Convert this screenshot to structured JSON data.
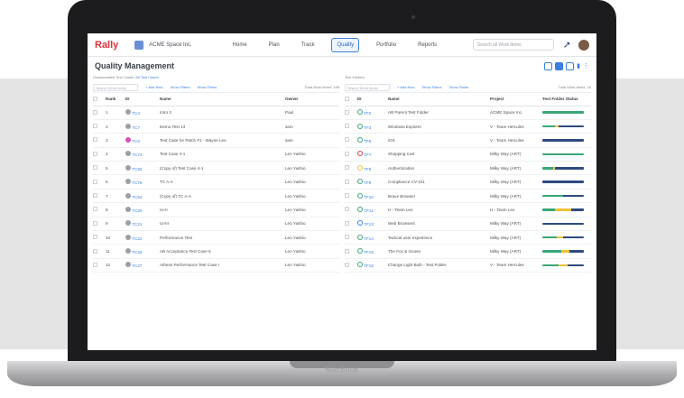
{
  "device": {
    "label": "MacBook"
  },
  "app": {
    "logo": "Rally",
    "workspace": "ACME Space Inc.",
    "nav": [
      "Home",
      "Plan",
      "Track",
      "Quality",
      "Portfolio",
      "Reports"
    ],
    "active_nav": "Quality",
    "search_placeholder": "Search all Work Items",
    "page_title": "Quality Management"
  },
  "test_cases": {
    "label": "Unassociated Test Cases",
    "label_link": "All Test Cases",
    "toolbar": {
      "search": "Search Work Items",
      "add": "+ Add New",
      "filters": "Show Filters",
      "fields": "Show Fields",
      "total": "Total Work Items: 198"
    },
    "columns": [
      "Rank",
      "ID",
      "Name",
      "Owner"
    ],
    "rows": [
      {
        "rank": "1",
        "id": "TC4",
        "name": "Intro 2",
        "owner": "Paul",
        "icon": "grey"
      },
      {
        "rank": "2",
        "id": "TC7",
        "name": "Demo Test 13",
        "owner": "sam",
        "icon": "grey"
      },
      {
        "rank": "3",
        "id": "TC6",
        "name": "Test Case for Patch #1 - Wayne Lee",
        "owner": "sam",
        "icon": "pink"
      },
      {
        "rank": "4",
        "id": "TC74",
        "name": "Test Case 4-1",
        "owner": "Leo Yashio",
        "icon": "grey"
      },
      {
        "rank": "5",
        "id": "TC55",
        "name": "(Copy of) Test Case 4-1",
        "owner": "Leo Yashio",
        "icon": "grey"
      },
      {
        "rank": "6",
        "id": "TC79",
        "name": "TC A-A",
        "owner": "Leo Yashio",
        "icon": "grey"
      },
      {
        "rank": "7",
        "id": "TC54",
        "name": "(Copy of) TC A-A",
        "owner": "Leo Yashio",
        "icon": "grey"
      },
      {
        "rank": "8",
        "id": "TC20",
        "name": "UI-II",
        "owner": "Leo Yashio",
        "icon": "grey"
      },
      {
        "rank": "9",
        "id": "TC21",
        "name": "UI-III",
        "owner": "Leo Yashio",
        "icon": "grey"
      },
      {
        "rank": "10",
        "id": "TC22",
        "name": "Performance Test",
        "owner": "Leo Yashio",
        "icon": "grey"
      },
      {
        "rank": "11",
        "id": "TC25",
        "name": "AB Acceptance Test Case 6",
        "owner": "Leo Yashio",
        "icon": "grey"
      },
      {
        "rank": "12",
        "id": "TC27",
        "name": "Athens Performance Test Case I",
        "owner": "Leo Yashio",
        "icon": "grey"
      }
    ]
  },
  "test_folders": {
    "label": "Test Folders",
    "toolbar": {
      "search": "Search Work Items",
      "add": "+ Add New",
      "filters": "Show Filters",
      "fields": "Show Fields",
      "total": "Total Work Items: 19"
    },
    "columns": [
      "ID",
      "Name",
      "Project",
      "Test Folder Status"
    ],
    "rows": [
      {
        "id": "TF2",
        "name": "AB Parent Test Folder",
        "project": "ACME Space Inc.",
        "icon": "green",
        "status": [
          1.0,
          0,
          0
        ]
      },
      {
        "id": "TF3",
        "name": "Windows Explorer",
        "project": "V - Team Hercules",
        "icon": "green",
        "status": [
          0.3,
          0.1,
          0.6
        ]
      },
      {
        "id": "TF6",
        "name": "iOS",
        "project": "V - Team Hercules",
        "icon": "green",
        "status": [
          0,
          0,
          1.0
        ]
      },
      {
        "id": "TF7",
        "name": "Shopping Cart",
        "project": "Milky Way (ART)",
        "icon": "red",
        "status": [
          1.0,
          0,
          0
        ]
      },
      {
        "id": "TF5",
        "name": "Authentication",
        "project": "Milky Way (ART)",
        "icon": "yellow",
        "status": [
          0.25,
          0.05,
          0.7
        ]
      },
      {
        "id": "TF9",
        "name": "Compliance CV-101",
        "project": "Milky Way (ART)",
        "icon": "green",
        "status": [
          0,
          0,
          1.0
        ]
      },
      {
        "id": "TF10",
        "name": "Brave Browser",
        "project": "Milky Way (ART)",
        "icon": "green",
        "status": [
          0.5,
          0,
          0.5
        ]
      },
      {
        "id": "TF12",
        "name": "H - Team Leo",
        "project": "H - Team Leo",
        "icon": "green",
        "status": [
          0.3,
          0.4,
          0.3
        ]
      },
      {
        "id": "TF13",
        "name": "Web Browsers",
        "project": "Milky Way (ART)",
        "icon": "blue",
        "status": [
          0,
          0,
          1.0
        ]
      },
      {
        "id": "TF14",
        "name": "Tactical user experience",
        "project": "Milky Way (ART)",
        "icon": "green",
        "status": [
          0.35,
          0.15,
          0.5
        ]
      },
      {
        "id": "TF15",
        "name": "The Fox & Goose",
        "project": "Milky Way (ART)",
        "icon": "green",
        "status": [
          0.45,
          0.2,
          0.35
        ]
      },
      {
        "id": "TF16",
        "name": "Change Light Bulb - Test Folder",
        "project": "V - Team Hercules",
        "icon": "green",
        "status": [
          0.4,
          0.2,
          0.4
        ]
      }
    ]
  },
  "colors": {
    "pass": "#3aa676",
    "warn": "#f0c23a",
    "fail": "#e0404a",
    "none": "#2f4a80",
    "accent": "#3b7fe0"
  }
}
